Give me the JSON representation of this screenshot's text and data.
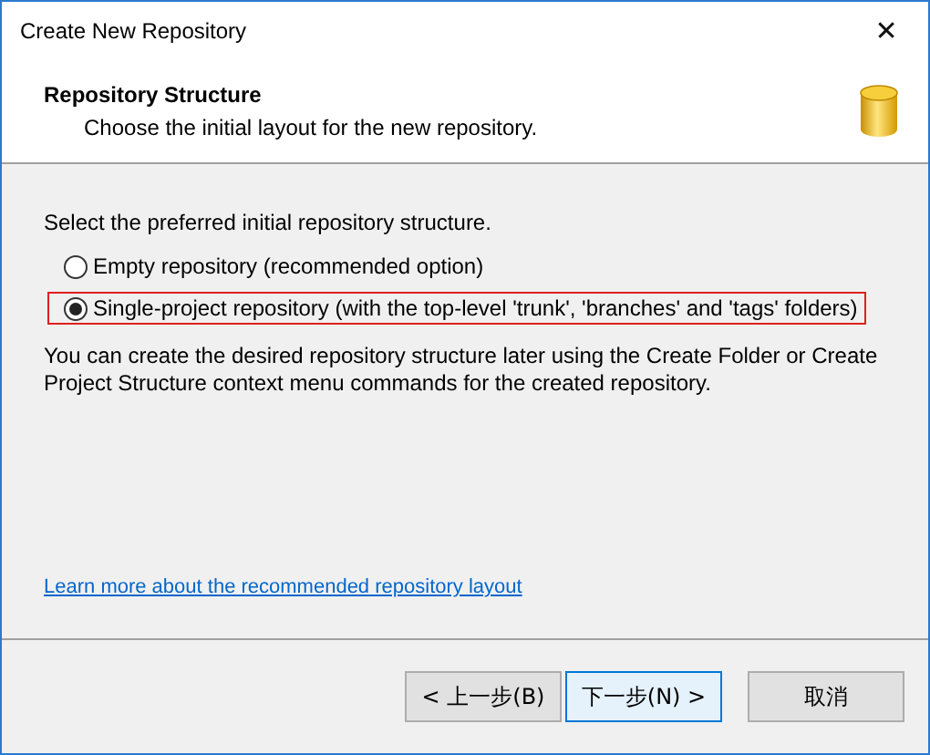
{
  "window": {
    "title": "Create New Repository",
    "close": "✕"
  },
  "header": {
    "title": "Repository Structure",
    "subtitle": "Choose the initial layout for the new repository."
  },
  "prompt": "Select the preferred initial repository structure.",
  "options": [
    {
      "label": "Empty repository (recommended option)",
      "selected": false,
      "highlighted": false
    },
    {
      "label": "Single-project repository (with the top-level 'trunk', 'branches' and 'tags' folders)",
      "selected": true,
      "highlighted": true
    }
  ],
  "description": "You can create the desired repository structure later using the Create Folder or Create Project Structure context menu commands for the created repository.",
  "link": "Learn more about the recommended repository layout",
  "buttons": [
    {
      "label": "< 上一步(B)",
      "default": false
    },
    {
      "label": "下一步(N) >",
      "default": true
    },
    {
      "label": "取消",
      "default": false
    }
  ]
}
